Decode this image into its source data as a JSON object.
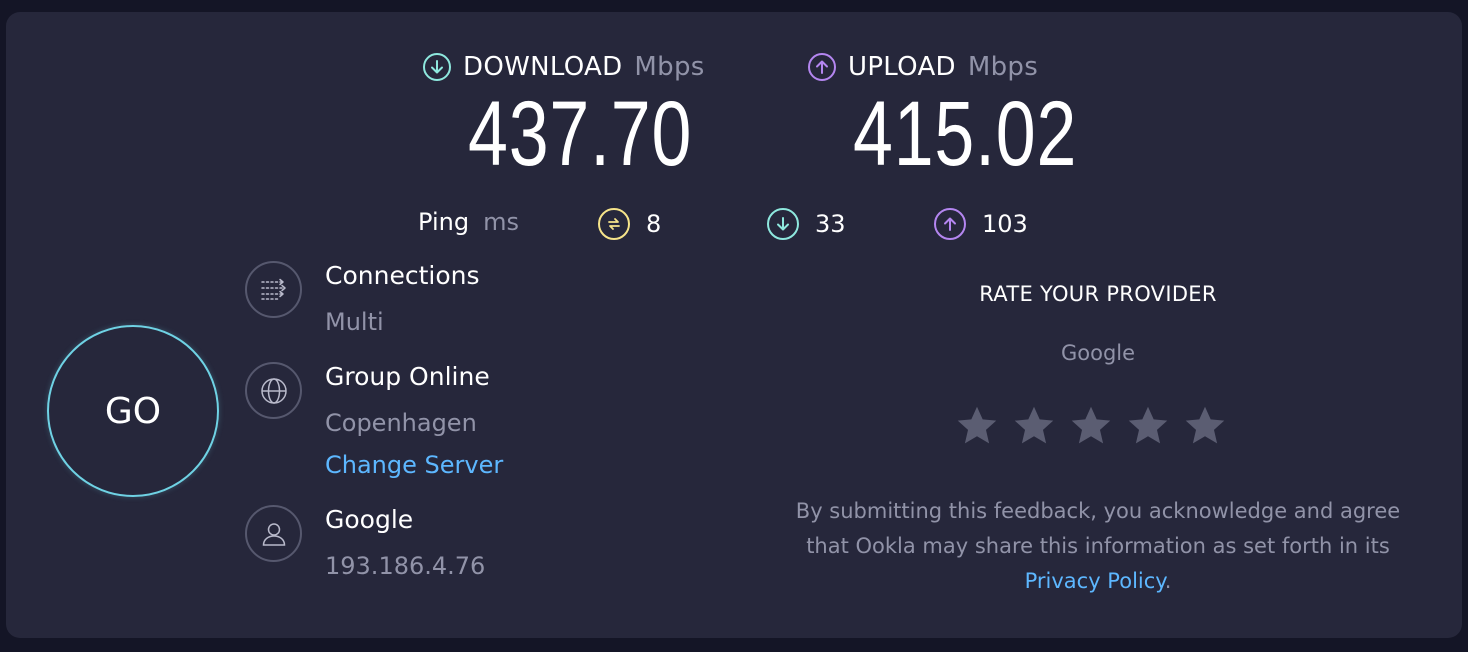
{
  "colors": {
    "download": "#8ee8de",
    "upload": "#b486f0",
    "ping": "#f6e48a",
    "go_ring": "#6fd2e4",
    "link": "#5db7ff",
    "panel": "#26273b",
    "muted": "#9193a8"
  },
  "download": {
    "label": "DOWNLOAD",
    "unit": "Mbps",
    "value": "437.70",
    "icon": "arrow-down-circle-icon"
  },
  "upload": {
    "label": "UPLOAD",
    "unit": "Mbps",
    "value": "415.02",
    "icon": "arrow-up-circle-icon"
  },
  "ping": {
    "label": "Ping",
    "unit": "ms",
    "idle": "8",
    "download": "33",
    "upload": "103",
    "icons": [
      "idle-latency-icon",
      "arrow-down-circle-icon",
      "arrow-up-circle-icon"
    ]
  },
  "go_label": "GO",
  "connections": {
    "title": "Connections",
    "value": "Multi",
    "icon": "connections-icon"
  },
  "server": {
    "name": "Group Online",
    "location": "Copenhagen",
    "change_label": "Change Server",
    "icon": "globe-icon"
  },
  "provider": {
    "name": "Google",
    "ip": "193.186.4.76",
    "icon": "user-icon"
  },
  "rate": {
    "title": "RATE YOUR PROVIDER",
    "provider": "Google",
    "stars": 5,
    "rating": 0,
    "disclaimer_line1": "By submitting this feedback, you acknowledge and agree",
    "disclaimer_line2": "that Ookla may share this information as set forth in its",
    "privacy_link": "Privacy Policy",
    "period": "."
  }
}
